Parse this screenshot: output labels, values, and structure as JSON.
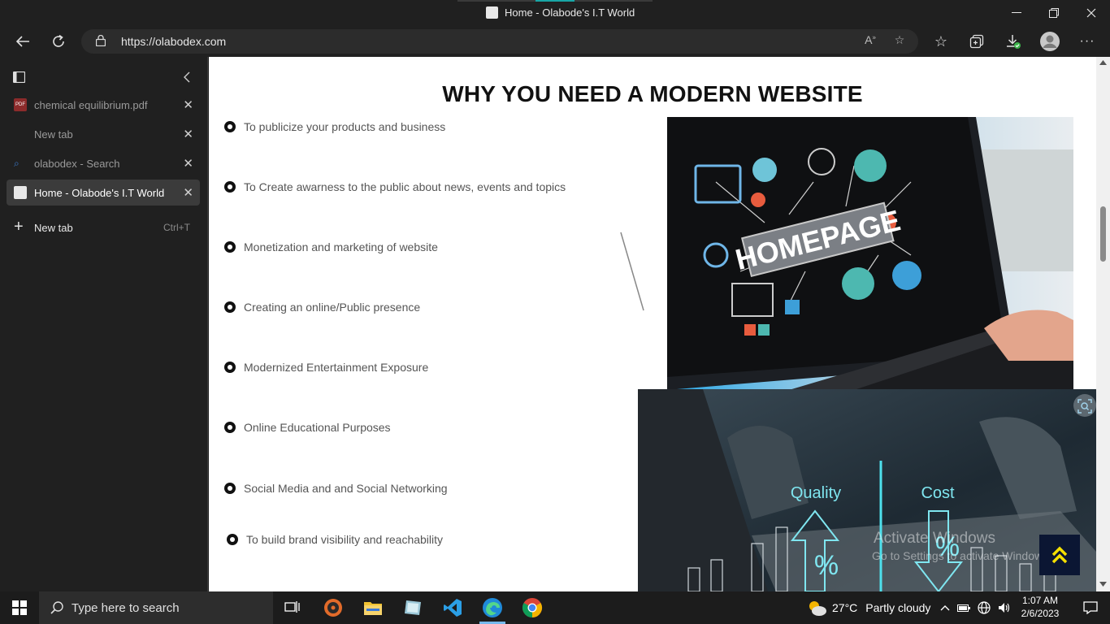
{
  "window": {
    "title": "Home - Olabode's I.T World"
  },
  "toolbar": {
    "url_host": "https://olabodex.com"
  },
  "sidebar": {
    "tabs": [
      {
        "label": "chemical equilibrium.pdf",
        "icon": "pdf-icon"
      },
      {
        "label": "New tab",
        "icon": "new-tab-page-icon"
      },
      {
        "label": "olabodex - Search",
        "icon": "search-icon"
      },
      {
        "label": "Home - Olabode's I.T World",
        "icon": "site-favicon",
        "active": true
      }
    ],
    "new_tab_label": "New tab",
    "new_tab_shortcut": "Ctrl+T"
  },
  "page": {
    "heading": "WHY YOU NEED A MODERN WEBSITE",
    "items": [
      "To publicize your products and business",
      "To Create awarness to the public about news, events and topics",
      "Monetization and marketing of website",
      "Creating an online/Public presence",
      "Modernized Entertainment Exposure",
      "Online Educational Purposes",
      "Social Media and and Social Networking",
      "To build brand visibility and reachability"
    ],
    "image1_text": "HOMEPAGE",
    "image2_quality": "Quality",
    "image2_cost": "Cost",
    "image2_percent_left": "%",
    "image2_percent_right": "%"
  },
  "watermark": {
    "line1": "Activate Windows",
    "line2": "Go to Settings to activate Windows."
  },
  "taskbar": {
    "search_placeholder": "Type here to search",
    "weather_temp": "27°C",
    "weather_text": "Partly cloudy",
    "time": "1:07 AM",
    "date": "2/6/2023"
  },
  "colors": {
    "browser_chrome": "#202020",
    "scroll_top_button": "#0b1633",
    "scroll_top_arrow": "#f5e000"
  }
}
